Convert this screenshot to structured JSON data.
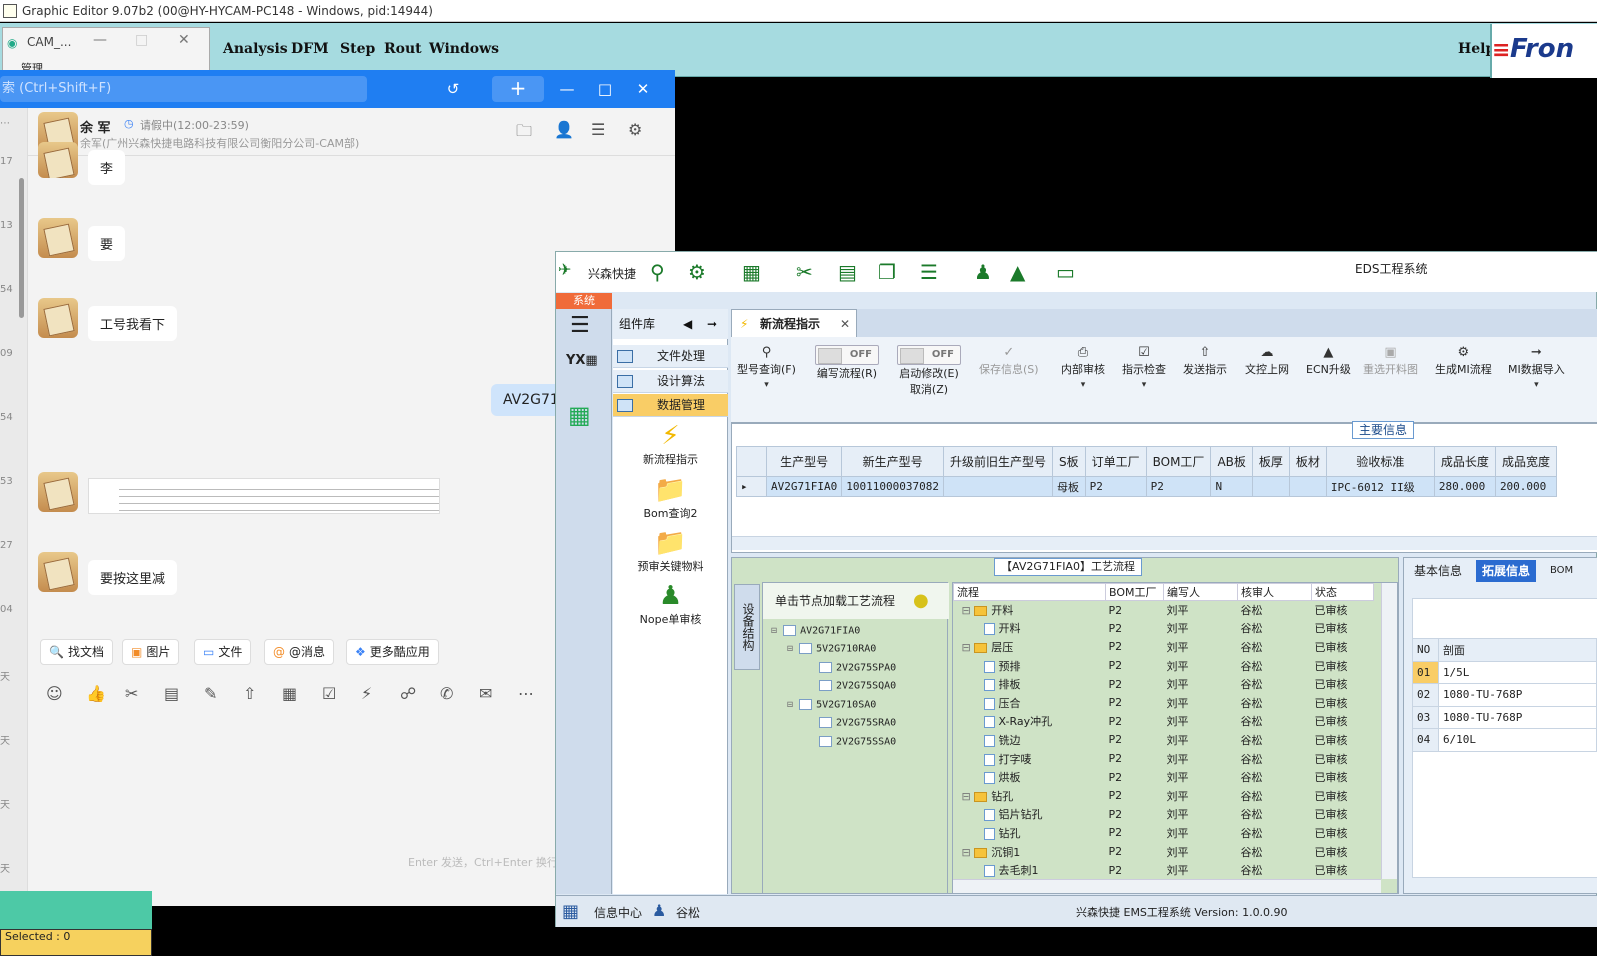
{
  "titlebar": {
    "text": "Graphic Editor 9.07b2 (00@HY-HYCAM-PC148 - Windows, pid:14944)"
  },
  "cam": {
    "tab_title": "CAM_...",
    "tab_sub": "管理",
    "menu": [
      "Analysis",
      "DFM",
      "Step",
      "Rout",
      "Windows"
    ],
    "help": "Help",
    "logo": "Fron",
    "selected": "Selected : 0"
  },
  "chat": {
    "search_placeholder": "索 (Ctrl+Shift+F)",
    "left_nums": [
      "17",
      "13",
      "54",
      "09",
      "54",
      "53",
      "27",
      "04",
      "天",
      "天",
      "天",
      "天"
    ],
    "contact_name": "余 军",
    "contact_status": "请假中(12:00-23:59)",
    "contact_org": "余军(广州兴森快捷电路科技有限公司衡阳分公司-CAM部)",
    "messages": [
      "李",
      "要",
      "工号我看下",
      "AV2G71",
      "要按这里减"
    ],
    "tools": [
      "找文档",
      "图片",
      "文件",
      "@消息",
      "更多酷应用"
    ],
    "input_hint": "Enter 发送，Ctrl+Enter 换行"
  },
  "eds": {
    "brand": "兴森快捷",
    "title": "EDS工程系统",
    "system_tab": "系统",
    "lib_title": "组件库",
    "lib_items": [
      "文件处理",
      "设计算法",
      "数据管理"
    ],
    "lib_apps": [
      "新流程指示",
      "Bom查询2",
      "预审关键物料",
      "Nope单审核"
    ],
    "active_tab": "新流程指示",
    "ribbon": {
      "query": "型号查询(F)",
      "edit_flow": "编写流程(R)",
      "start_modify": "启动修改(E)",
      "cancel": "取消(Z)",
      "toggle_off": "OFF",
      "save": "保存信息(S)",
      "internal_review": "内部审核",
      "check": "指示检查",
      "send": "发送指示",
      "upload": "文控上网",
      "ecn": "ECN升级",
      "reselect": "重选开料图",
      "gen_mi": "生成MI流程",
      "mi_import": "MI数据导入"
    },
    "main_label": "主要信息",
    "main_headers": [
      "生产型号",
      "新生产型号",
      "升级前旧生产型号",
      "S板",
      "订单工厂",
      "BOM工厂",
      "AB板",
      "板厚",
      "板材",
      "验收标准",
      "成品长度",
      "成品宽度"
    ],
    "main_row": [
      "AV2G71FIA0",
      "10011000037082",
      "",
      "母板",
      "P2",
      "P2",
      "N",
      "",
      "",
      "IPC-6012 II级",
      "280.000",
      "200.000"
    ],
    "proc_label": "【AV2G71FIA0】工艺流程",
    "device_tab": "设备结构",
    "tree_hint": "单击节点加载工艺流程",
    "tree": [
      "AV2G71FIA0",
      "5V2G710RA0",
      "2V2G75SPA0",
      "2V2G75SQA0",
      "5V2G710SA0",
      "2V2G75SRA0",
      "2V2G75SSA0"
    ],
    "flow_headers": [
      "流程",
      "BOM工厂",
      "编写人",
      "核审人",
      "状态"
    ],
    "flow_rows": [
      {
        "name": "开料",
        "folder": true,
        "bom": "P2",
        "writer": "刘平",
        "reviewer": "谷松",
        "status": "已审核"
      },
      {
        "name": "开料",
        "folder": false,
        "bom": "P2",
        "writer": "刘平",
        "reviewer": "谷松",
        "status": "已审核"
      },
      {
        "name": "层压",
        "folder": true,
        "bom": "P2",
        "writer": "刘平",
        "reviewer": "谷松",
        "status": "已审核"
      },
      {
        "name": "预排",
        "folder": false,
        "bom": "P2",
        "writer": "刘平",
        "reviewer": "谷松",
        "status": "已审核"
      },
      {
        "name": "排板",
        "folder": false,
        "bom": "P2",
        "writer": "刘平",
        "reviewer": "谷松",
        "status": "已审核"
      },
      {
        "name": "压合",
        "folder": false,
        "bom": "P2",
        "writer": "刘平",
        "reviewer": "谷松",
        "status": "已审核"
      },
      {
        "name": "X-Ray冲孔",
        "folder": false,
        "bom": "P2",
        "writer": "刘平",
        "reviewer": "谷松",
        "status": "已审核"
      },
      {
        "name": "铣边",
        "folder": false,
        "bom": "P2",
        "writer": "刘平",
        "reviewer": "谷松",
        "status": "已审核"
      },
      {
        "name": "打字唛",
        "folder": false,
        "bom": "P2",
        "writer": "刘平",
        "reviewer": "谷松",
        "status": "已审核"
      },
      {
        "name": "烘板",
        "folder": false,
        "bom": "P2",
        "writer": "刘平",
        "reviewer": "谷松",
        "status": "已审核"
      },
      {
        "name": "钻孔",
        "folder": true,
        "bom": "P2",
        "writer": "刘平",
        "reviewer": "谷松",
        "status": "已审核"
      },
      {
        "name": "铝片钻孔",
        "folder": false,
        "bom": "P2",
        "writer": "刘平",
        "reviewer": "谷松",
        "status": "已审核"
      },
      {
        "name": "钻孔",
        "folder": false,
        "bom": "P2",
        "writer": "刘平",
        "reviewer": "谷松",
        "status": "已审核"
      },
      {
        "name": "沉铜1",
        "folder": true,
        "bom": "P2",
        "writer": "刘平",
        "reviewer": "谷松",
        "status": "已审核"
      },
      {
        "name": "去毛刺1",
        "folder": false,
        "bom": "P2",
        "writer": "刘平",
        "reviewer": "谷松",
        "status": "已审核"
      }
    ],
    "right_tabs": [
      "基本信息",
      "拓展信息",
      "BOM"
    ],
    "base_headers": [
      "NO",
      "剖面"
    ],
    "base_rows": [
      [
        "01",
        "1/5L"
      ],
      [
        "02",
        "1080-TU-768P"
      ],
      [
        "03",
        "1080-TU-768P"
      ],
      [
        "04",
        "6/10L"
      ]
    ],
    "status": {
      "info_center": "信息中心",
      "user": "谷松",
      "version": "兴森快捷 EMS工程系统 Version: 1.0.0.90"
    }
  },
  "colors": {
    "chat_blue": "#1f7ef2",
    "cam_teal": "#a6dbe0",
    "selected_yellow": "#f9cd66",
    "eds_green": "#1b7a2a"
  }
}
